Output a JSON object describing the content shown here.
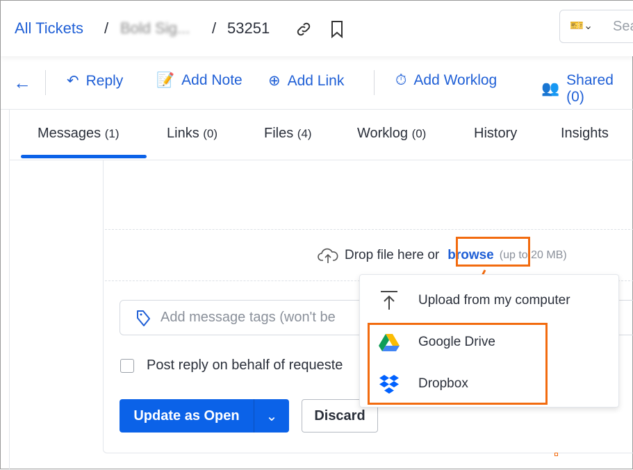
{
  "breadcrumb": {
    "root": "All Tickets",
    "sep": "/",
    "middle": "Bold Sig...",
    "ticket_id": "53251"
  },
  "search": {
    "placeholder": "Sea"
  },
  "toolbar": {
    "reply": "Reply",
    "add_note": "Add Note",
    "add_link": "Add Link",
    "add_worklog": "Add Worklog",
    "shared": "Shared (0)"
  },
  "tabs": [
    {
      "label": "Messages",
      "count": "(1)"
    },
    {
      "label": "Links",
      "count": "(0)"
    },
    {
      "label": "Files",
      "count": "(4)"
    },
    {
      "label": "Worklog",
      "count": "(0)"
    },
    {
      "label": "History",
      "count": ""
    },
    {
      "label": "Insights",
      "count": ""
    }
  ],
  "upload": {
    "drop_text": "Drop file here or",
    "browse": "browse",
    "limit": "(up to 20 MB)"
  },
  "menu": {
    "items": [
      "Upload from my computer",
      "Google Drive",
      "Dropbox"
    ]
  },
  "tags": {
    "placeholder": "Add message tags (won't be"
  },
  "checkbox": {
    "label": "Post reply on behalf of requeste"
  },
  "actions": {
    "update": "Update as Open",
    "discard": "Discard"
  },
  "colors": {
    "accent": "#0b62e8",
    "highlight": "#f26b0f"
  }
}
